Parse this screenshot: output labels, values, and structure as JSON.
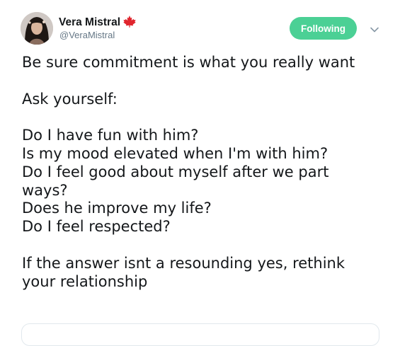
{
  "tweet": {
    "author": {
      "name": "Vera Mistral",
      "handle": "@VeraMistral",
      "flag_icon": "canada-flag-icon"
    },
    "follow_label": "Following",
    "follow_color": "#4bd095",
    "menu_icon": "chevron-down-icon",
    "text_lines": [
      "Be sure commitment is what you really want",
      "",
      "Ask yourself:",
      "",
      "Do I have fun with him?",
      "Is my mood elevated when I'm with him?",
      "Do I feel good about myself after we part",
      "ways?",
      "Does he improve my life?",
      "Do I feel respected?",
      "",
      "If the answer isnt a resounding yes, rethink",
      "your relationship"
    ]
  }
}
